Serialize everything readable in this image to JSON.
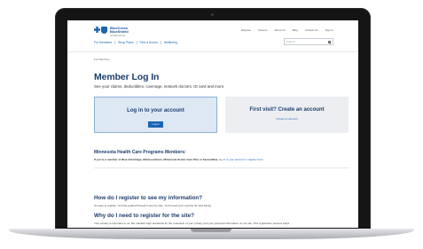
{
  "header": {
    "logo_line1": "BlueCross",
    "logo_line2": "BlueShield",
    "logo_sub": "of Minnesota",
    "utility_links": [
      "Espanol",
      "Careers",
      "About Us",
      "Blog",
      "Contact Us",
      "Sign In"
    ],
    "nav_links": [
      "For Members",
      "Shop Plans",
      "Find a Doctor",
      "Wellbeing"
    ],
    "search_placeholder": "Search"
  },
  "breadcrumb": "For Members",
  "main": {
    "title": "Member Log In",
    "subtitle": "See your claims, deductibles, coverage, network doctors, ID card and more.",
    "login_card": {
      "title": "Log in to your account",
      "button": "Log in"
    },
    "register_card": {
      "title": "First visit? Create an account",
      "link": "Create an account"
    },
    "programs": {
      "title": "Minnesota Health Care Programs Members:",
      "text_strong": "If you're a member of Blue Advantage, MinnesotaCare, Minnesota Senior Care Plus or SecureBlue,",
      "text_link": "log in to your account or register here."
    },
    "faq": [
      {
        "question": "How do I register to see my information?",
        "answer": "It's easy to register. You'll be guided through it step by step. You'll need your member ID card handy."
      },
      {
        "question": "Why do I need to register for the site?",
        "answer": "Your privacy is important to us. We maintain high standards for the protection of your privacy and your personal information on our site. This registration process helps"
      }
    ]
  },
  "colors": {
    "brand_blue": "#1b64b0",
    "heading_navy": "#1d3f6e",
    "login_card_bg": "#dde8f3",
    "register_card_bg": "#eceef1",
    "laptop_bezel": "#151515"
  }
}
